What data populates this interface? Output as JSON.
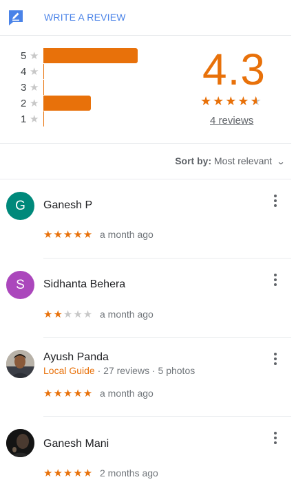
{
  "header": {
    "write_review_label": "WRITE A REVIEW",
    "icon": "write-review-icon"
  },
  "summary": {
    "average": "4.3",
    "average_stars": 4.5,
    "reviews_link": "4 reviews",
    "histogram": [
      {
        "label": "5",
        "fraction": 0.5
      },
      {
        "label": "4",
        "fraction": 0.0
      },
      {
        "label": "3",
        "fraction": 0.0
      },
      {
        "label": "2",
        "fraction": 0.25
      },
      {
        "label": "1",
        "fraction": 0.0
      }
    ]
  },
  "sort": {
    "prefix": "Sort by:",
    "value": "Most relevant",
    "icon": "chevron-down-icon"
  },
  "reviews": [
    {
      "initial": "G",
      "avatar_color": "#00897b",
      "name": "Ganesh P",
      "rating": 5,
      "time": "a month ago"
    },
    {
      "initial": "S",
      "avatar_color": "#ab47bc",
      "name": "Sidhanta Behera",
      "rating": 2,
      "time": "a month ago"
    },
    {
      "name": "Ayush Panda",
      "guide_label": "Local Guide",
      "guide_meta": "· 27 reviews · 5 photos",
      "rating": 5,
      "time": "a month ago",
      "avatar_type": "photo"
    },
    {
      "name": "Ganesh Mani",
      "rating": 5,
      "time": "2 months ago",
      "avatar_type": "photo"
    }
  ],
  "colors": {
    "accent": "#e8710a",
    "link_blue": "#4a83e8",
    "star_off": "#c8c8c8"
  }
}
